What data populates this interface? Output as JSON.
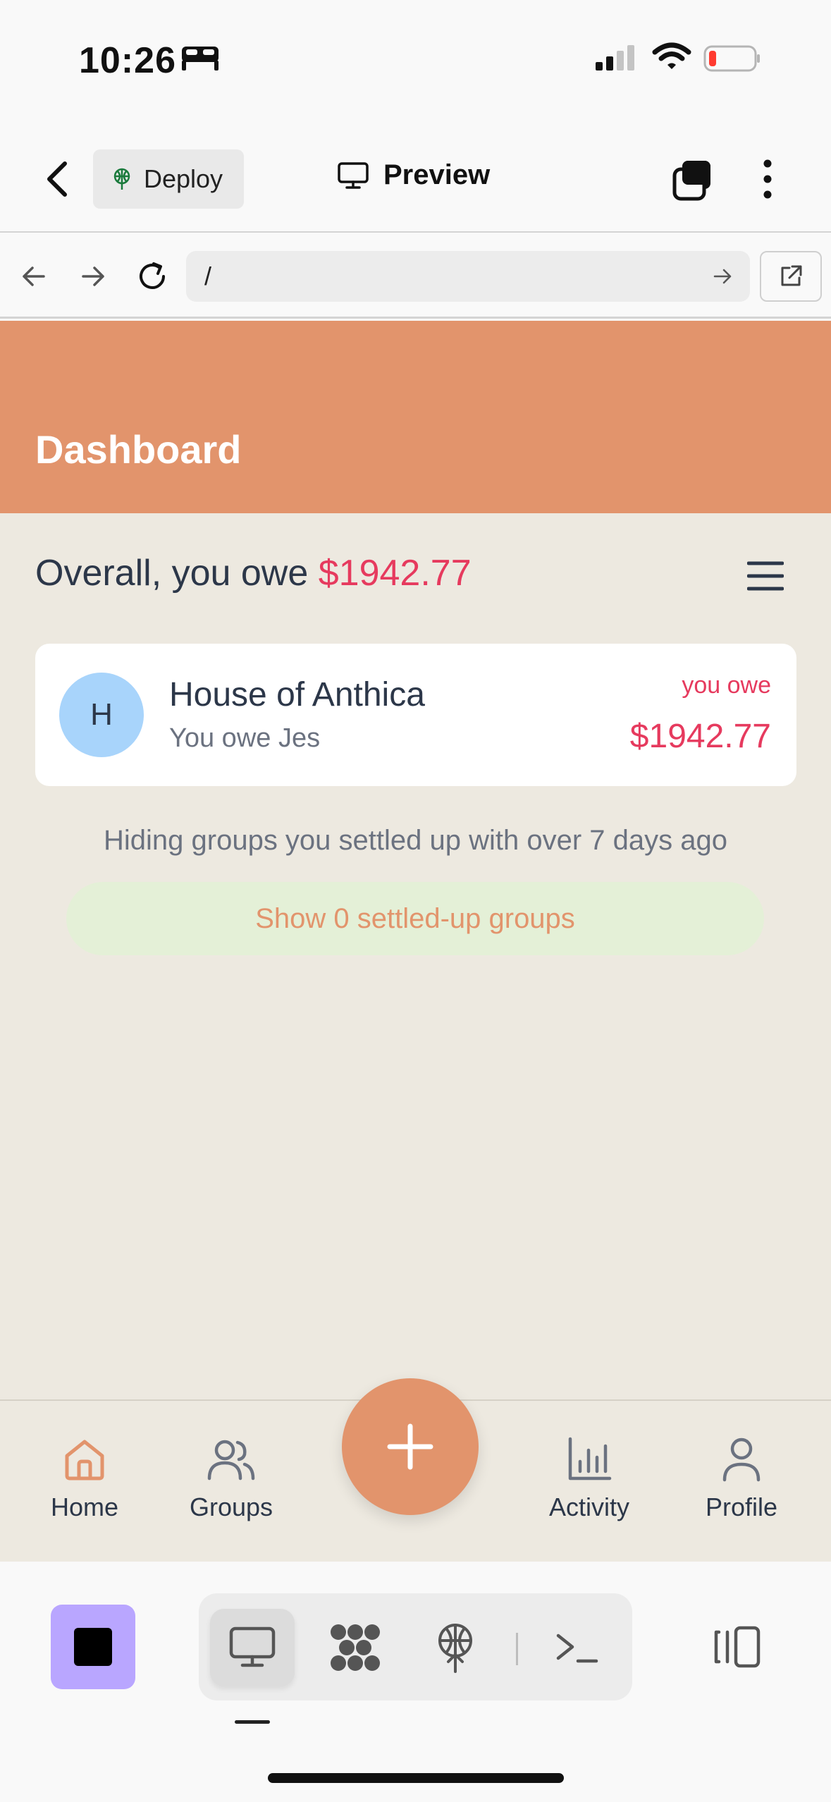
{
  "status_bar": {
    "time": "10:26",
    "icons": [
      "bed-icon",
      "cellular-signal-icon",
      "wifi-icon",
      "battery-low-icon"
    ]
  },
  "toolbar": {
    "deploy_label": "Deploy",
    "preview_label": "Preview"
  },
  "url_bar": {
    "url": "/"
  },
  "page": {
    "title": "Dashboard",
    "overall_prefix": "Overall, you owe ",
    "overall_amount": "$1942.77",
    "groups": [
      {
        "initial": "H",
        "name": "House of Anthica",
        "subtitle": "You owe Jes",
        "status_label": "you owe",
        "amount": "$1942.77"
      }
    ],
    "hiding_text": "Hiding groups you settled up with over 7 days ago",
    "show_settled_label": "Show 0 settled-up groups"
  },
  "bottom_nav": {
    "home": "Home",
    "groups": "Groups",
    "activity": "Activity",
    "profile": "Profile"
  },
  "colors": {
    "accent": "#e2946c",
    "owe_red": "#e63a5e",
    "page_bg": "#ede9e0",
    "settled_bg": "#e4f0d7",
    "avatar_blue": "#a8d4fb",
    "agent_purple": "#b9a6ff"
  }
}
